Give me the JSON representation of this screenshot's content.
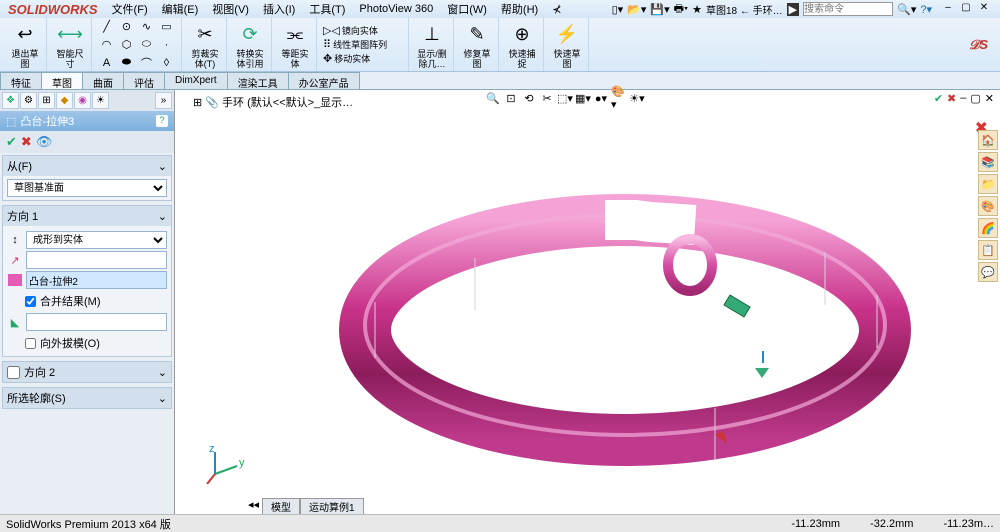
{
  "app": {
    "name": "SOLIDWORKS"
  },
  "menu": {
    "file": "文件(F)",
    "edit": "编辑(E)",
    "view": "视图(V)",
    "insert": "插入(I)",
    "tools": "工具(T)",
    "pv360": "PhotoView 360",
    "window": "窗口(W)",
    "help": "帮助(H)"
  },
  "breadcrumb_top": "草图18 ← 手环…",
  "search_placeholder": "搜索命令",
  "ribbon": {
    "exit_sketch": "退出草\n图",
    "smart_dim": "智能尺\n寸",
    "trim": "剪裁实\n体(T)",
    "convert": "转换实\n体引用",
    "offset": "等距实\n体",
    "mirror": "镜向实体",
    "linear_pattern": "线性草图阵列",
    "move": "移动实体",
    "show_hide": "显示/删\n除几…",
    "repair": "修复草\n图",
    "quick_snap": "快速捕\n捉",
    "rapid_sketch": "快速草\n图"
  },
  "tabs": {
    "feature": "特征",
    "sketch": "草图",
    "surface": "曲面",
    "evaluate": "评估",
    "dimxpert": "DimXpert",
    "render": "渲染工具",
    "office": "办公室产品"
  },
  "feature_mgr": {
    "title": "凸台-拉伸3",
    "from_label": "从(F)",
    "from_value": "草图基准面",
    "dir1_label": "方向 1",
    "end_condition": "成形到实体",
    "body_value": "凸台-拉伸2",
    "merge": "合并结果(M)",
    "draft_out": "向外拔模(O)",
    "dir2_label": "方向 2",
    "contours_label": "所选轮廓(S)"
  },
  "viewport": {
    "breadcrumb": "手环 (默认<<默认>_显示…"
  },
  "bottom_tabs": {
    "model": "模型",
    "motion": "运动算例1"
  },
  "status": {
    "version": "SolidWorks Premium 2013 x64 版",
    "x": "-11.23mm",
    "y": "-32.2mm",
    "z": "-11.23m…"
  }
}
